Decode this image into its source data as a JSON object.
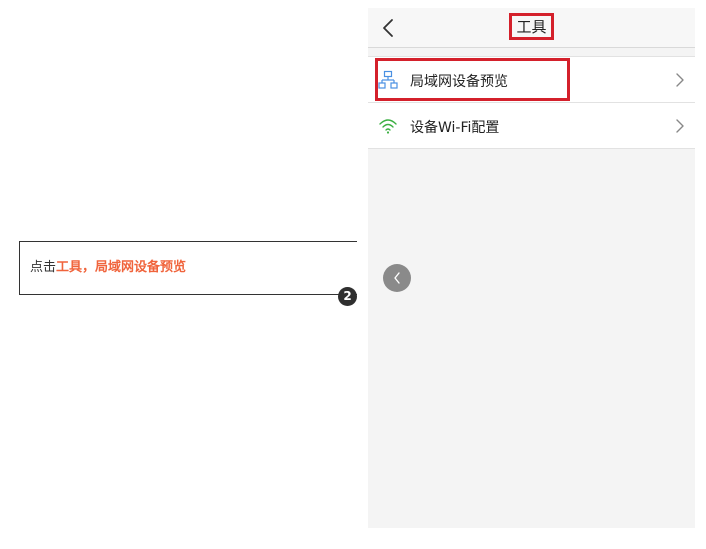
{
  "callout": {
    "prefix": "点击",
    "highlight_1": "工具",
    "separator": "，",
    "highlight_2": "局域网设备预览",
    "step_number": "2"
  },
  "navbar": {
    "title": "工具",
    "back_icon": "chevron-left-icon"
  },
  "menu": {
    "items": [
      {
        "label": "局域网设备预览",
        "icon": "network-devices-icon",
        "icon_color": "#4a90e2"
      },
      {
        "label": "设备Wi-Fi配置",
        "icon": "wifi-icon",
        "icon_color": "#3cb043"
      }
    ]
  },
  "colors": {
    "highlight_red": "#d4202b",
    "callout_accent": "#f0643c",
    "badge_dark": "#2f2f2f",
    "screen_bg": "#f4f4f4"
  }
}
